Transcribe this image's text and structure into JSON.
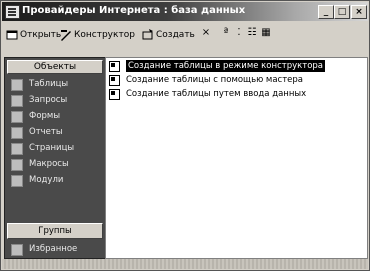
{
  "window": {
    "title": "Провайдеры Интернета : база данных"
  },
  "title_buttons": [
    {
      "name": "minimize",
      "glyph": "_"
    },
    {
      "name": "maximize",
      "glyph": "□"
    },
    {
      "name": "close",
      "glyph": "×"
    }
  ],
  "toolbar": {
    "open_label": "Открыть",
    "design_label": "Конструктор",
    "create_label": "Создать",
    "delete_glyph": "×",
    "large_icons_glyph": "ª",
    "small_icons_glyph": "⁚",
    "list_glyph": "☷",
    "details_glyph": "▦"
  },
  "nav": {
    "header": "Объекты",
    "items": [
      {
        "label": "Таблицы",
        "icon": "table-icon"
      },
      {
        "label": "Запросы",
        "icon": "query-icon"
      },
      {
        "label": "Формы",
        "icon": "form-icon"
      },
      {
        "label": "Отчеты",
        "icon": "report-icon"
      },
      {
        "label": "Страницы",
        "icon": "page-icon"
      },
      {
        "label": "Макросы",
        "icon": "macro-icon"
      },
      {
        "label": "Модули",
        "icon": "module-icon"
      }
    ],
    "groups_label": "Группы",
    "favorites_label": "Избранное"
  },
  "list": {
    "items": [
      {
        "label": "Создание таблицы в режиме конструктора",
        "selected": true
      },
      {
        "label": "Создание таблицы с помощью мастера",
        "selected": false
      },
      {
        "label": "Создание таблицы путем ввода данных",
        "selected": false
      }
    ]
  }
}
